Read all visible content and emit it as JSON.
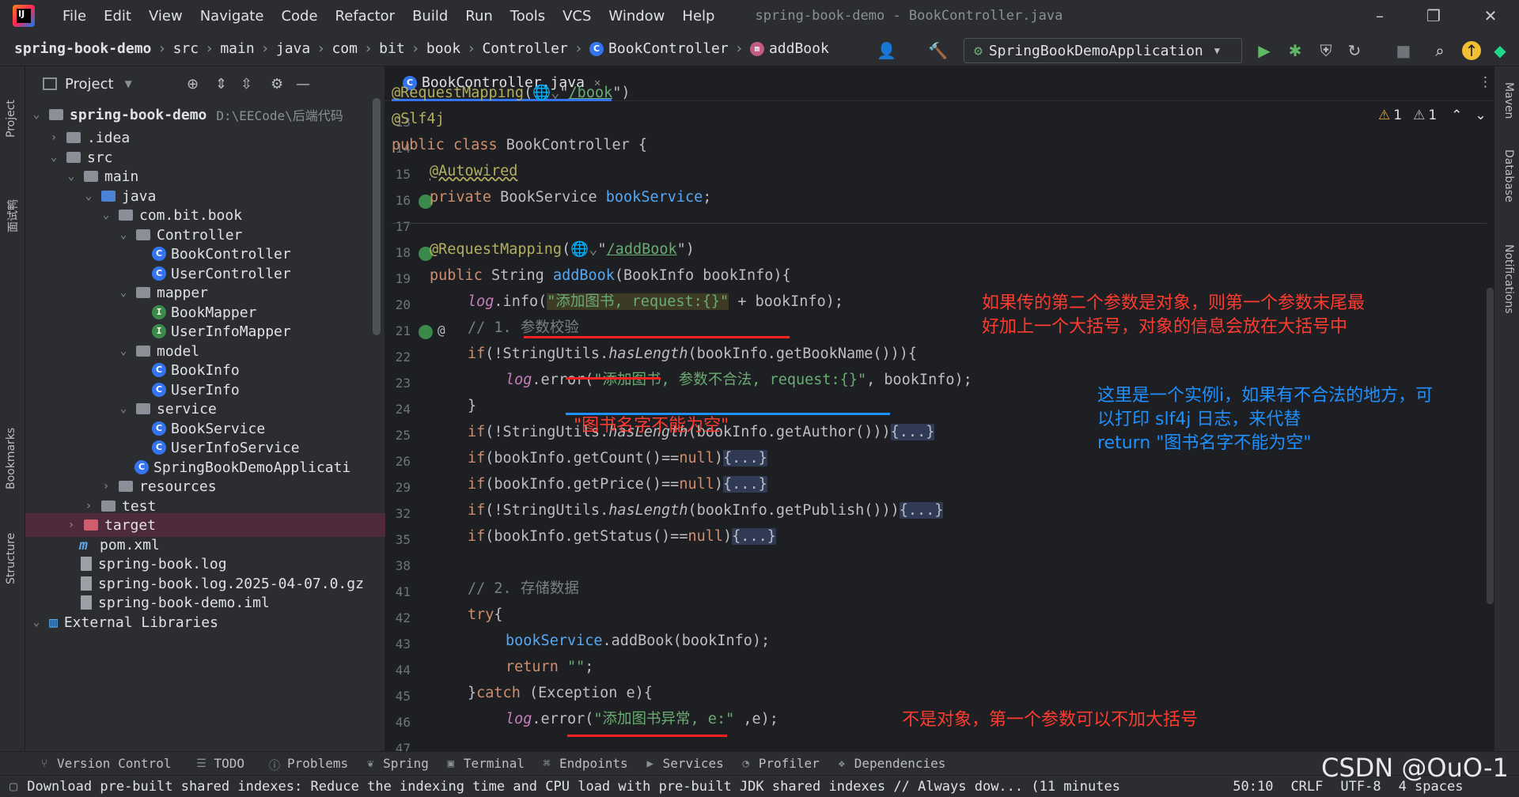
{
  "menu": {
    "items": [
      "File",
      "Edit",
      "View",
      "Navigate",
      "Code",
      "Refactor",
      "Build",
      "Run",
      "Tools",
      "VCS",
      "Window",
      "Help"
    ],
    "window_title": "spring-book-demo - BookController.java"
  },
  "breadcrumb": [
    "spring-book-demo",
    "src",
    "main",
    "java",
    "com",
    "bit",
    "book",
    "Controller",
    "BookController",
    "addBook"
  ],
  "run_config": "SpringBookDemoApplication",
  "project": {
    "title": "Project",
    "tree": [
      {
        "label": "spring-book-demo",
        "extra": "D:\\EECode\\后端代码"
      },
      {
        "label": ".idea"
      },
      {
        "label": "src"
      },
      {
        "label": "main"
      },
      {
        "label": "java"
      },
      {
        "label": "com.bit.book"
      },
      {
        "label": "Controller"
      },
      {
        "label": "BookController"
      },
      {
        "label": "UserController"
      },
      {
        "label": "mapper"
      },
      {
        "label": "BookMapper"
      },
      {
        "label": "UserInfoMapper"
      },
      {
        "label": "model"
      },
      {
        "label": "BookInfo"
      },
      {
        "label": "UserInfo"
      },
      {
        "label": "service"
      },
      {
        "label": "BookService"
      },
      {
        "label": "UserInfoService"
      },
      {
        "label": "SpringBookDemoApplicati"
      },
      {
        "label": "resources"
      },
      {
        "label": "test"
      },
      {
        "label": "target"
      },
      {
        "label": "pom.xml"
      },
      {
        "label": "spring-book.log"
      },
      {
        "label": "spring-book.log.2025-04-07.0.gz"
      },
      {
        "label": "spring-book-demo.iml"
      },
      {
        "label": "External Libraries"
      }
    ]
  },
  "editor": {
    "tab": "BookController.java",
    "warnings": "1",
    "weak_warnings": "1",
    "line_numbers": [
      "13",
      "14",
      "15",
      "16",
      "17",
      "18",
      "19",
      "20",
      "21",
      "22",
      "23",
      "24",
      "25",
      "26",
      "29",
      "32",
      "35",
      "38",
      "41",
      "42",
      "43",
      "44",
      "45",
      "46",
      "47"
    ]
  },
  "annotations": {
    "a1_line1": "如果传的第二个参数是对象，则第一个参数末尾最",
    "a1_line2": "好加上一个大括号，对象的信息会放在大括号中",
    "a2": "\"图书名字不能为空\"",
    "a3_line1": "这里是一个实例i，如果有不合法的地方，可",
    "a3_line2": "以打印 slf4j 日志，来代替",
    "a3_line3": "return \"图书名字不能为空\"",
    "a4": "不是对象，第一个参数可以不加大括号"
  },
  "left_strip": [
    "Project",
    "面试鸭",
    "Bookmarks",
    "Structure"
  ],
  "right_strip": [
    "Maven",
    "Database",
    "Notifications"
  ],
  "bottom_tools": [
    "Version Control",
    "TODO",
    "Problems",
    "Spring",
    "Terminal",
    "Endpoints",
    "Services",
    "Profiler",
    "Dependencies"
  ],
  "status": {
    "message": "Download pre-built shared indexes: Reduce the indexing time and CPU load with pre-built JDK shared indexes // Always dow... (11 minutes",
    "position": "50:10",
    "line_sep": "CRLF",
    "encoding": "UTF-8",
    "indent": "4 spaces"
  },
  "watermark": "CSDN @OuO-1"
}
